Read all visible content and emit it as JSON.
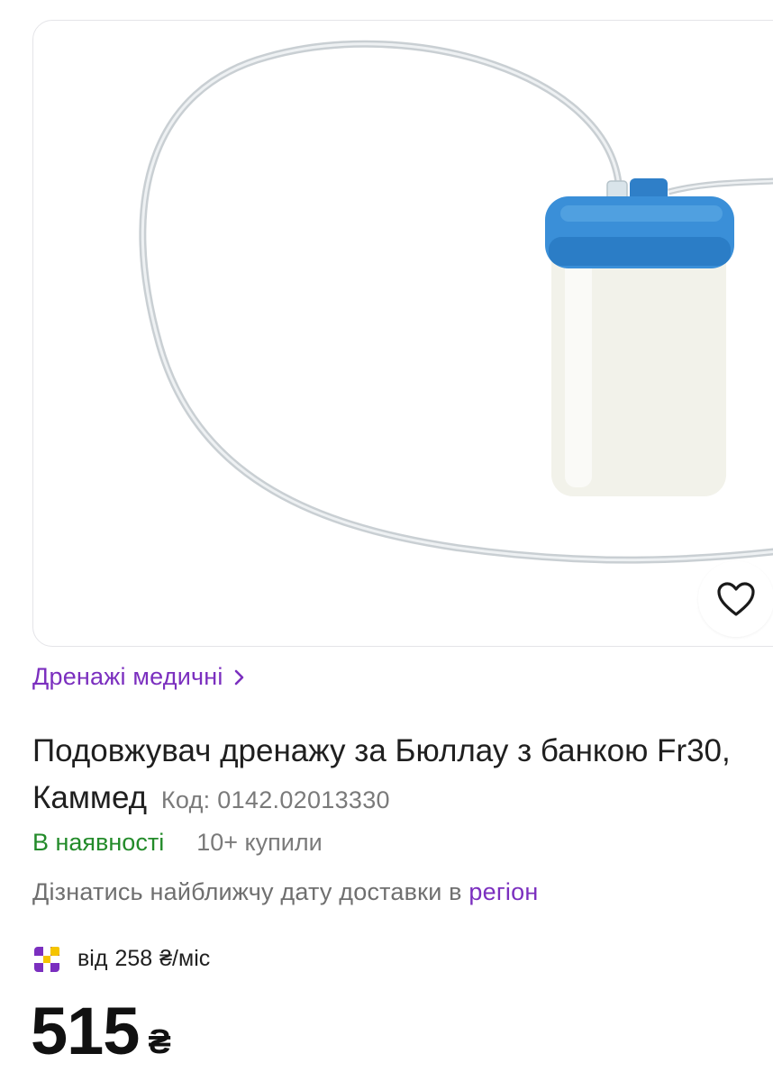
{
  "colors": {
    "accent": "#7b2fbf",
    "in_stock": "#238b2a",
    "muted": "#7a7a7a",
    "cap_blue": "#3a8fd8"
  },
  "product_image": {
    "favorite_icon": "heart-outline-icon"
  },
  "breadcrumb": {
    "label": "Дренажі медичні",
    "icon": "chevron-right-icon"
  },
  "product": {
    "title": "Подовжувач дренажу за Бюллау з банкою Fr30, Каммед",
    "code": "Код: 0142.02013330"
  },
  "availability": {
    "status": "В наявності",
    "bought": "10+ купили"
  },
  "delivery": {
    "text": "Дізнатись найближчу дату доставки в",
    "link": "регіон"
  },
  "installment": {
    "icon": "installment-logo-icon",
    "prefix": "від",
    "amount": "258",
    "suffix": "₴/міс"
  },
  "price": {
    "amount": "515",
    "currency": "₴"
  }
}
